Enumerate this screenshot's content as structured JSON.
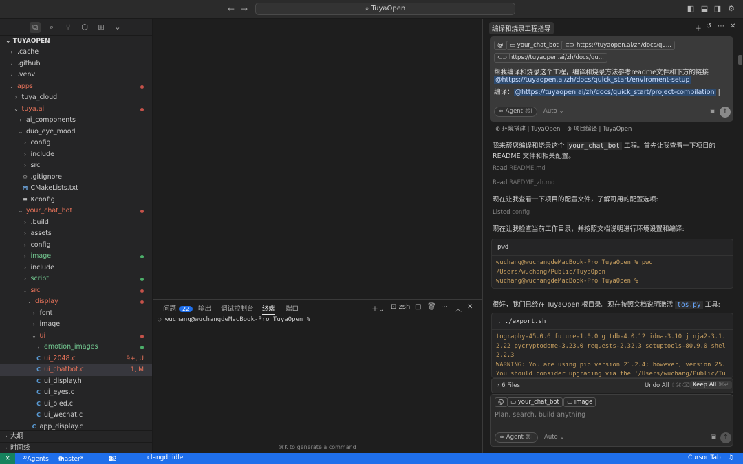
{
  "titlebar": {
    "search_text": "TuyaOpen",
    "back": "←",
    "forward": "→"
  },
  "explorer": {
    "title": "TUYAOPEN",
    "rows": [
      {
        "label": ".cache",
        "depth": 0,
        "exp": false,
        "color": "#cccccc"
      },
      {
        "label": ".github",
        "depth": 0,
        "exp": false,
        "color": "#cccccc"
      },
      {
        "label": ".venv",
        "depth": 0,
        "exp": false,
        "color": "#cccccc"
      },
      {
        "label": "apps",
        "depth": 0,
        "exp": true,
        "color": "#e8735a",
        "dot": "#c5524a"
      },
      {
        "label": "tuya_cloud",
        "depth": 1,
        "exp": false,
        "color": "#cccccc"
      },
      {
        "label": "tuya.ai",
        "depth": 1,
        "exp": true,
        "color": "#e8735a",
        "dot": "#c5524a"
      },
      {
        "label": "ai_components",
        "depth": 2,
        "exp": false,
        "color": "#cccccc"
      },
      {
        "label": "duo_eye_mood",
        "depth": 2,
        "exp": true,
        "color": "#cccccc"
      },
      {
        "label": "config",
        "depth": 3,
        "exp": false,
        "color": "#cccccc"
      },
      {
        "label": "include",
        "depth": 3,
        "exp": false,
        "color": "#cccccc"
      },
      {
        "label": "src",
        "depth": 3,
        "exp": false,
        "color": "#cccccc"
      },
      {
        "label": ".gitignore",
        "depth": 3,
        "icon": "gear",
        "color": "#cccccc"
      },
      {
        "label": "CMakeLists.txt",
        "depth": 3,
        "icon": "cmake",
        "color": "#cccccc"
      },
      {
        "label": "Kconfig",
        "depth": 3,
        "icon": "lines",
        "color": "#cccccc"
      },
      {
        "label": "your_chat_bot",
        "depth": 2,
        "exp": true,
        "color": "#e8735a",
        "dot": "#c5524a"
      },
      {
        "label": ".build",
        "depth": 3,
        "exp": false,
        "color": "#cccccc"
      },
      {
        "label": "assets",
        "depth": 3,
        "exp": false,
        "color": "#cccccc"
      },
      {
        "label": "config",
        "depth": 3,
        "exp": false,
        "color": "#cccccc"
      },
      {
        "label": "image",
        "depth": 3,
        "exp": false,
        "color": "#73c991",
        "dot": "#4caf6a"
      },
      {
        "label": "include",
        "depth": 3,
        "exp": false,
        "color": "#cccccc"
      },
      {
        "label": "script",
        "depth": 3,
        "exp": false,
        "color": "#73c991",
        "dot": "#4caf6a"
      },
      {
        "label": "src",
        "depth": 3,
        "exp": true,
        "color": "#e8735a",
        "dot": "#c5524a"
      },
      {
        "label": "display",
        "depth": 4,
        "exp": true,
        "color": "#e8735a",
        "dot": "#c5524a"
      },
      {
        "label": "font",
        "depth": 5,
        "exp": false,
        "color": "#cccccc"
      },
      {
        "label": "image",
        "depth": 5,
        "exp": false,
        "color": "#cccccc"
      },
      {
        "label": "ui",
        "depth": 5,
        "exp": true,
        "color": "#e8735a",
        "dot": "#c5524a"
      },
      {
        "label": "emotion_images",
        "depth": 6,
        "exp": false,
        "color": "#73c991",
        "dot": "#4caf6a"
      },
      {
        "label": "ui_2048.c",
        "depth": 6,
        "icon": "c",
        "color": "#e8735a",
        "badge": "9+, U",
        "badgecolor": "#e8735a"
      },
      {
        "label": "ui_chatbot.c",
        "depth": 6,
        "icon": "c",
        "color": "#e8735a",
        "badge": "1, M",
        "badgecolor": "#e8735a",
        "selected": true
      },
      {
        "label": "ui_display.h",
        "depth": 6,
        "icon": "c",
        "color": "#cccccc"
      },
      {
        "label": "ui_eyes.c",
        "depth": 6,
        "icon": "c",
        "color": "#cccccc"
      },
      {
        "label": "ui_oled.c",
        "depth": 6,
        "icon": "c",
        "color": "#cccccc"
      },
      {
        "label": "ui_wechat.c",
        "depth": 6,
        "icon": "c",
        "color": "#cccccc"
      },
      {
        "label": "app_display.c",
        "depth": 5,
        "icon": "c",
        "color": "#cccccc"
      }
    ],
    "outline_label": "大纲",
    "timeline_label": "时间线"
  },
  "panel": {
    "tabs": {
      "problems": "问题",
      "problems_count": "22",
      "output": "输出",
      "debug": "调试控制台",
      "terminal": "终端",
      "ports": "端口"
    },
    "shell": "zsh",
    "prompt": "wuchang@wuchangdeMacBook-Pro TuyaOpen %",
    "hint": "⌘K to generate a command"
  },
  "chat": {
    "tab_title": "编译和烧录工程指导",
    "bubble": {
      "chip1": "your_chat_bot",
      "chip2": "https://tuyaopen.ai/zh/docs/qu...",
      "chip3": "https://tuyaopen.ai/zh/docs/qu...",
      "line1": "帮我编译和烧录这个工程，编译和烧录方法参考readme文件和下方的链接",
      "line2": "@https://tuyaopen.ai/zh/docs/quick_start/enviroment-setup",
      "line3_label": "编译：",
      "line3_link": "@https://tuyaopen.ai/zh/docs/quick_start/project-compilation",
      "agent": "Agent",
      "agent_kbd": "⌘I",
      "auto": "Auto"
    },
    "refs": {
      "ref1": "环境搭建 | TuyaOpen",
      "ref2": "项目编译 | TuyaOpen"
    },
    "msg1a": "我来帮您编译和烧录这个",
    "msg1_code": "your_chat_bot",
    "msg1b": "工程。首先让我查看一下项目的",
    "msg1c": "README 文件和相关配置。",
    "read1_verb": "Read",
    "read1_file": "README.md",
    "read2_verb": "Read",
    "read2_file": "RAEDME_zh.md",
    "msg2": "现在让我查看一下项目的配置文件，了解可用的配置选项:",
    "listed_verb": "Listed",
    "listed_item": "config",
    "msg3": "现在让我检查当前工作目录，并按照文档说明进行环境设置和编译:",
    "code1_cmd": "pwd",
    "code1_out": "wuchang@wuchangdeMacBook-Pro TuyaOpen % pwd\n/Users/wuchang/Public/TuyaOpen\nwuchang@wuchangdeMacBook-Pro TuyaOpen %",
    "msg4a": "很好，我们已经在 TuyaOpen 根目录。现在按照文档说明激活",
    "msg4_code": "tos.py",
    "msg4b": "工具:",
    "code2_cmd": ". ./export.sh",
    "code2_out": "tography-45.0.6 future-1.0.0 gitdb-4.0.12 idna-3.10 jinja2-3.1.\n2.22 pycryptodome-3.23.0 requests-2.32.3 setuptools-80.9.0 shel\n2.2.3\nWARNING: You are using pip version 21.2.4; however, version 25.\nYou should consider upgrading via the '/Users/wuchang/Public/Tu",
    "files": {
      "label": "6 Files",
      "undo": "Undo All",
      "undo_kbd": "⇧⌘⌫",
      "keep": "Keep All",
      "keep_kbd": "⌘↵"
    },
    "input": {
      "chip1": "your_chat_bot",
      "chip2": "image",
      "placeholder": "Plan, search, build anything",
      "agent": "Agent",
      "agent_kbd": "⌘I",
      "auto": "Auto"
    }
  },
  "status": {
    "agents": "Agents",
    "branch": "master*",
    "errors": "22",
    "warnings": "0",
    "clangd": "clangd: idle",
    "cursor_tab": "Cursor Tab"
  },
  "colors": {
    "accent": "#1f6feb",
    "modified": "#e8735a",
    "untracked": "#73c991"
  }
}
